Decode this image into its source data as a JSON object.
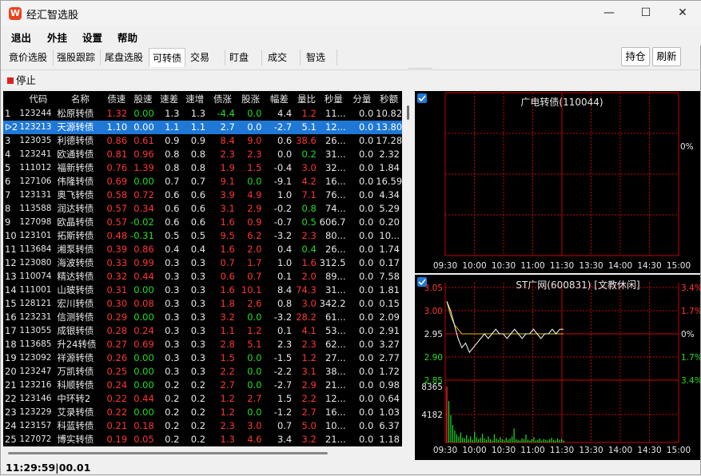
{
  "window": {
    "logo": "W",
    "title": "经汇智选股",
    "btn_minimize": "—",
    "btn_maximize": "☐",
    "btn_close": "✕"
  },
  "menu": [
    "退出",
    "外挂",
    "设置",
    "帮助"
  ],
  "tabs": [
    {
      "label": "竟价选股"
    },
    {
      "label": "强股跟踪"
    },
    {
      "label": "尾盘选股"
    },
    {
      "label": "可转债"
    },
    {
      "label": "交易"
    },
    {
      "label": "盯盘"
    },
    {
      "label": "成交"
    },
    {
      "label": "智选"
    }
  ],
  "active_tab": "可转债",
  "right_buttons": {
    "hold": "持仓",
    "refresh": "刷新"
  },
  "stop_label": "停止",
  "status_text": "11:29:59|00.01",
  "colors": {
    "up": "#ff3535",
    "down": "#22dd22",
    "flat": "#e8e8e8",
    "selected_row": "#1f78d6",
    "grid": "#cc0000"
  },
  "table": {
    "columns": [
      "",
      "代码",
      "名称",
      "债速",
      "股速",
      "速差",
      "速增",
      "债涨",
      "股涨",
      "幅差",
      "量比",
      "秒量",
      "分量",
      "秒额"
    ],
    "rows": [
      [
        "1",
        "123244",
        "松原转债",
        "1.32",
        "0.00",
        "1.3",
        "1.3",
        "-4.4",
        "0.0",
        "4.4",
        "1.2",
        "11...",
        "0.0",
        "10.82"
      ],
      [
        "2",
        "123213",
        "天源转债",
        "1.10",
        "0.00",
        "1.1",
        "1.1",
        "2.7",
        "0.0",
        "-2.7",
        "5.1",
        "12...",
        "0.0",
        "13.80"
      ],
      [
        "3",
        "123035",
        "利德转债",
        "0.86",
        "0.61",
        "0.9",
        "0.9",
        "8.4",
        "9.0",
        "0.6",
        "38.6",
        "26...",
        "0.0",
        "17.28"
      ],
      [
        "4",
        "123241",
        "欧通转债",
        "0.81",
        "0.96",
        "0.8",
        "0.8",
        "2.3",
        "2.3",
        "0.0",
        "0.2",
        "31...",
        "0.0",
        "2.32"
      ],
      [
        "5",
        "111012",
        "福新转债",
        "0.76",
        "1.39",
        "0.8",
        "0.8",
        "1.9",
        "1.5",
        "-0.4",
        "3.0",
        "32...",
        "0.0",
        "1.84"
      ],
      [
        "6",
        "127106",
        "伟隆转债",
        "0.69",
        "0.00",
        "0.7",
        "0.7",
        "9.1",
        "0.0",
        "-9.1",
        "4.2",
        "16...",
        "0.0",
        "16.59"
      ],
      [
        "7",
        "123131",
        "奥飞转债",
        "0.58",
        "0.72",
        "0.6",
        "0.6",
        "3.9",
        "4.9",
        "1.0",
        "7.1",
        "76...",
        "0.0",
        "4.34"
      ],
      [
        "8",
        "113588",
        "润达转债",
        "0.57",
        "0.34",
        "0.6",
        "0.6",
        "3.1",
        "2.9",
        "-0.2",
        "0.8",
        "74...",
        "0.0",
        "5.29"
      ],
      [
        "9",
        "127098",
        "欧晶转债",
        "0.57",
        "-0.02",
        "0.6",
        "0.6",
        "1.6",
        "0.9",
        "-0.7",
        "0.5",
        "606.7",
        "0.0",
        "0.20"
      ],
      [
        "10",
        "123101",
        "拓斯转债",
        "0.48",
        "-0.31",
        "0.5",
        "0.5",
        "9.5",
        "6.2",
        "-3.2",
        "2.3",
        "80...",
        "0.0",
        "10..."
      ],
      [
        "11",
        "113684",
        "湘泵转债",
        "0.39",
        "0.86",
        "0.4",
        "0.4",
        "1.6",
        "2.0",
        "0.4",
        "0.4",
        "26...",
        "0.0",
        "1.74"
      ],
      [
        "12",
        "123080",
        "海波转债",
        "0.33",
        "0.99",
        "0.3",
        "0.3",
        "0.7",
        "1.7",
        "1.0",
        "1.6",
        "312.5",
        "0.0",
        "0.17"
      ],
      [
        "13",
        "110074",
        "精达转债",
        "0.32",
        "0.44",
        "0.3",
        "0.3",
        "0.6",
        "0.7",
        "0.1",
        "2.0",
        "89...",
        "0.0",
        "7.58"
      ],
      [
        "14",
        "111001",
        "山玻转债",
        "0.31",
        "0.00",
        "0.3",
        "0.3",
        "1.6",
        "10.1",
        "8.4",
        "74.3",
        "31...",
        "0.0",
        "1.81"
      ],
      [
        "15",
        "128121",
        "宏川转债",
        "0.30",
        "0.08",
        "0.3",
        "0.3",
        "1.8",
        "2.6",
        "0.8",
        "3.0",
        "342.2",
        "0.0",
        "0.15"
      ],
      [
        "16",
        "123231",
        "信测转债",
        "0.29",
        "0.00",
        "0.3",
        "0.3",
        "3.2",
        "0.0",
        "-3.2",
        "28.2",
        "61...",
        "0.0",
        "2.09"
      ],
      [
        "17",
        "113055",
        "成银转债",
        "0.28",
        "0.24",
        "0.3",
        "0.3",
        "1.1",
        "1.2",
        "0.1",
        "4.1",
        "53...",
        "0.0",
        "2.91"
      ],
      [
        "18",
        "113685",
        "升24转债",
        "0.27",
        "0.69",
        "0.3",
        "0.3",
        "2.8",
        "5.1",
        "2.3",
        "2.3",
        "62...",
        "0.0",
        "3.27"
      ],
      [
        "19",
        "123092",
        "祥源转债",
        "0.26",
        "0.00",
        "0.3",
        "0.3",
        "1.5",
        "0.0",
        "-1.5",
        "1.2",
        "27...",
        "0.0",
        "2.77"
      ],
      [
        "20",
        "123247",
        "万凯转债",
        "0.25",
        "0.00",
        "0.3",
        "0.3",
        "2.2",
        "0.0",
        "-2.2",
        "3.1",
        "38...",
        "0.0",
        "1.72"
      ],
      [
        "21",
        "123216",
        "科顺转债",
        "0.24",
        "0.00",
        "0.2",
        "0.2",
        "2.7",
        "0.0",
        "-2.7",
        "2.9",
        "21...",
        "0.0",
        "0.98"
      ],
      [
        "22",
        "123146",
        "中环转2",
        "0.22",
        "0.44",
        "0.2",
        "0.2",
        "1.2",
        "2.7",
        "1.5",
        "2.2",
        "12...",
        "0.0",
        "0.64"
      ],
      [
        "23",
        "123229",
        "艾录转债",
        "0.22",
        "0.00",
        "0.2",
        "0.2",
        "1.2",
        "0.0",
        "-1.2",
        "2.7",
        "16...",
        "0.0",
        "1.03"
      ],
      [
        "24",
        "123157",
        "科蓝转债",
        "0.21",
        "0.18",
        "0.2",
        "0.2",
        "2.3",
        "3.0",
        "0.7",
        "5.0",
        "10...",
        "0.0",
        "6.37"
      ],
      [
        "25",
        "127072",
        "博实转债",
        "0.19",
        "0.05",
        "0.2",
        "0.2",
        "1.3",
        "4.6",
        "3.4",
        "3.2",
        "21...",
        "0.0",
        "1.18"
      ]
    ],
    "row_colors": [
      [
        "w",
        "w",
        "w",
        "r",
        "g",
        "w",
        "w",
        "g",
        "g",
        "w",
        "r",
        "w",
        "w",
        "w"
      ],
      [
        "w",
        "w",
        "w",
        "w",
        "w",
        "w",
        "w",
        "w",
        "w",
        "w",
        "w",
        "w",
        "w",
        "w"
      ]
    ]
  },
  "chart_top": {
    "title": "广电转债(110044)",
    "right_label": "0%",
    "x_ticks": [
      "09:30",
      "10:00",
      "10:30",
      "11:00",
      "11:30",
      "13:30",
      "14:00",
      "14:30",
      "15:00"
    ]
  },
  "chart_bottom": {
    "title": "ST广网(600831)  [文教休闲]",
    "price_ticks": [
      "3.05",
      "3.00",
      "2.95",
      "2.90",
      "2.85"
    ],
    "pct_ticks": [
      "3.4%",
      "1.7%",
      "0%",
      "1.7%",
      "3.4%"
    ],
    "volume_ticks": [
      "8365",
      "4182"
    ],
    "x_ticks": [
      "09:30",
      "10:00",
      "10:30",
      "11:00",
      "11:30",
      "13:30",
      "14:00",
      "14:30",
      "15:00"
    ]
  },
  "chart_data": [
    {
      "type": "line",
      "title": "广电转债(110044)",
      "x": [
        "09:30",
        "10:00",
        "10:30",
        "11:00",
        "11:30",
        "13:30",
        "14:00",
        "14:30",
        "15:00"
      ],
      "series": [],
      "grid": true
    },
    {
      "type": "line",
      "title": "ST广网(600831)  [文教休闲]",
      "x": [
        "09:30",
        "10:00",
        "10:30",
        "11:00",
        "11:30",
        "13:30",
        "14:00",
        "14:30",
        "15:00"
      ],
      "ylim": [
        2.85,
        3.05
      ],
      "y_ticks": [
        3.05,
        3.0,
        2.95,
        2.9,
        2.85
      ],
      "pct_ticks": [
        "3.4%",
        "1.7%",
        "0%",
        "1.7%",
        "3.4%"
      ],
      "series": [
        {
          "values": [
            3.02,
            3.0,
            2.97,
            2.94,
            2.92,
            2.93,
            2.91,
            2.92,
            2.93,
            2.94,
            2.95,
            2.94,
            2.95,
            2.96,
            2.95,
            2.95,
            2.94,
            2.95,
            2.96,
            2.95,
            2.94,
            2.95,
            2.95,
            2.96,
            2.95,
            2.94,
            2.95,
            2.95,
            2.96,
            2.95,
            2.96,
            2.96
          ]
        },
        {
          "values": [
            3.02,
            2.99,
            2.97,
            2.96,
            2.95,
            2.95,
            2.95,
            2.95,
            2.95,
            2.95,
            2.95,
            2.95,
            2.95,
            2.95,
            2.95,
            2.95,
            2.95,
            2.95,
            2.95,
            2.95,
            2.95,
            2.95,
            2.95,
            2.95,
            2.95,
            2.95,
            2.95,
            2.95,
            2.95,
            2.95,
            2.95,
            2.95
          ]
        }
      ],
      "volume": {
        "ylim": [
          0,
          8365
        ],
        "values": [
          8365,
          6200,
          4100,
          2600,
          1800,
          1200,
          900,
          1500,
          700,
          600,
          1100,
          500,
          900,
          400,
          1600,
          800,
          500,
          700,
          1300,
          600,
          400,
          900,
          500,
          300,
          1200,
          600,
          400,
          800,
          500,
          300,
          700,
          400,
          600,
          900,
          2100,
          500,
          400,
          300,
          600,
          500,
          1200,
          400,
          300,
          500,
          800,
          300,
          400,
          600,
          300,
          500,
          400,
          300,
          500,
          700,
          400,
          300,
          600,
          400,
          500,
          300
        ]
      }
    }
  ]
}
